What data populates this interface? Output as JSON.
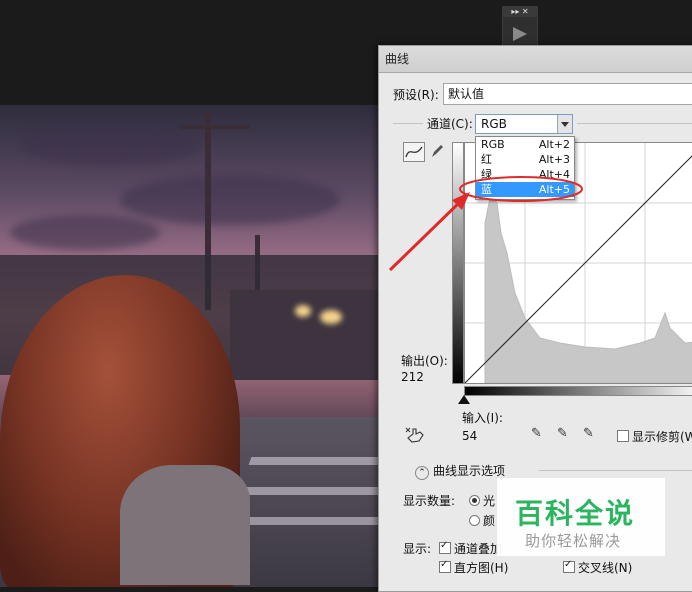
{
  "dialog": {
    "title": "曲线",
    "preset_label": "预设(R):",
    "preset_value": "默认值",
    "channel_label": "通道(C):",
    "channel_value": "RGB",
    "channel_options": [
      {
        "label": "RGB",
        "shortcut": "Alt+2"
      },
      {
        "label": "红",
        "shortcut": "Alt+3"
      },
      {
        "label": "绿",
        "shortcut": "Alt+4"
      },
      {
        "label": "蓝",
        "shortcut": "Alt+5",
        "selected": true
      }
    ],
    "output_label": "输出(O):",
    "output_value": "212",
    "input_label": "输入(I):",
    "input_value": "54",
    "show_clipping_label": "显示修剪(W",
    "curve_options_label": "曲线显示选项",
    "show_amount_label": "显示数量:",
    "amount_option1": "光",
    "amount_option2": "颜",
    "show_label": "显示:",
    "show_overlay_label": "通道叠加",
    "histogram_label": "直方图(H)",
    "intersection_label": "交叉线(N)"
  },
  "mini_panel": {
    "header": "▸▸ ✕"
  },
  "watermark": {
    "title": "百科全说",
    "subtitle": "助你轻松解决"
  },
  "colors": {
    "highlight": "#3399ff",
    "annotation": "#e02a2a",
    "watermark_green": "#2bb55f"
  },
  "icons": [
    "curve-tool-icon",
    "pencil-icon",
    "hand-adjust-icon",
    "eyedropper-black-icon",
    "eyedropper-gray-icon",
    "eyedropper-white-icon",
    "expand-icon"
  ]
}
